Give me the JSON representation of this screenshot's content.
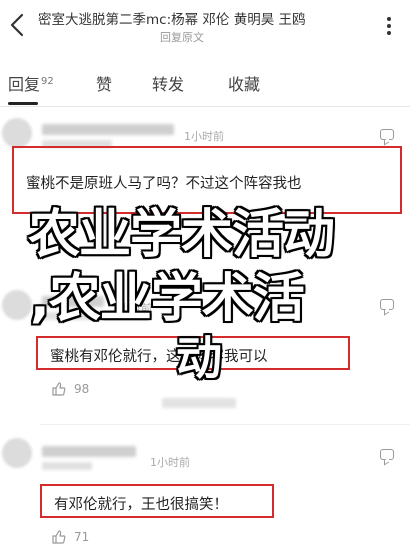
{
  "header": {
    "title": "密室大逃脱第二季mc:杨幂 邓伦 黄明昊 王鸥",
    "subtitle": "回复原文"
  },
  "tabs": [
    {
      "label": "回复",
      "count": "92"
    },
    {
      "label": "赞"
    },
    {
      "label": "转发"
    },
    {
      "label": "收藏"
    }
  ],
  "comments": [
    {
      "time": "1小时前",
      "text": "蜜桃不是原班人马了吗？不过这个阵容我也",
      "likes": ""
    },
    {
      "time": "1小时前",
      "text": "蜜桃有邓伦就行，这个阵容我可以",
      "likes": "98"
    },
    {
      "time": "1小时前",
      "text": "有邓伦就行，王也很搞笑！",
      "likes": "71"
    }
  ],
  "overlay": {
    "line1": "农业学术活动",
    "line2": ",农业学术活",
    "line3": "动"
  }
}
